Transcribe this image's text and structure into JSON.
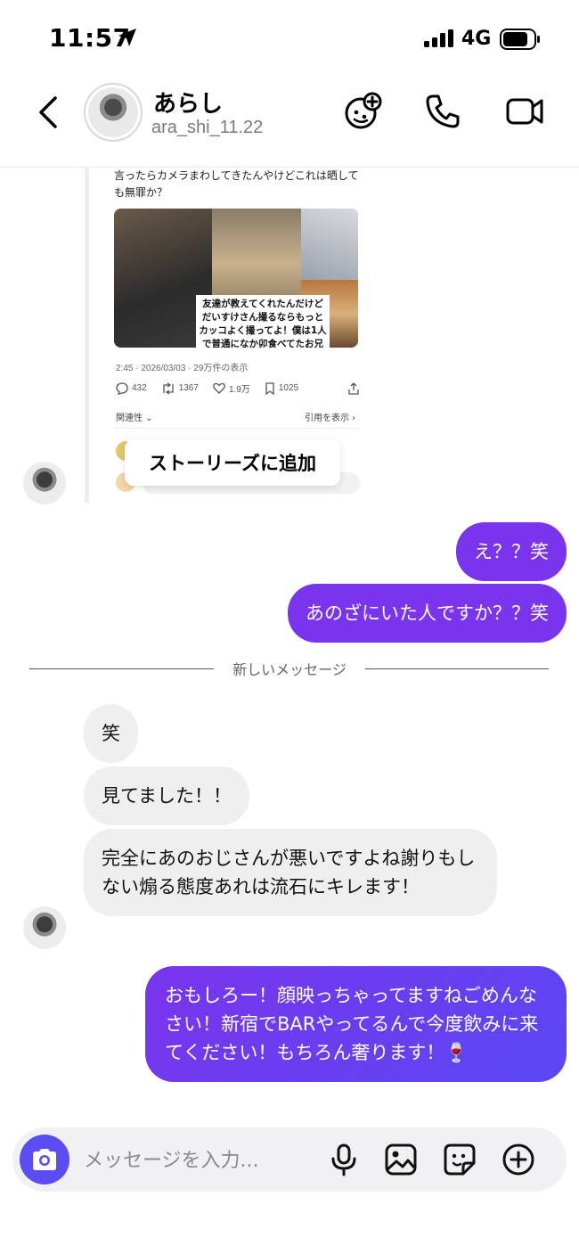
{
  "status_bar": {
    "time": "11:57",
    "network": "4G"
  },
  "header": {
    "name": "あらし",
    "username": "ara_shi_11.22"
  },
  "shared_post": {
    "text": "言ったらカメラまわしてきたんやけどこれは晒しても無罪か？",
    "overlay_text": "友達が教えてくれたんだけどだいすけさん撮るならもっとカッコよく撮ってよ！僕は1人で普通になか卯食べてたお兄さんだよ！うどんこぼしたおじさん謝らないあたり本物の匂いを感じた！@yogidaisuke またこの3人でなか卯行きたいな！",
    "meta": "2:45 · 2026/03/03 · 29万件の表示",
    "stats": {
      "replies": "432",
      "reposts": "1367",
      "likes": "1.9万",
      "bookmarks": "1025"
    },
    "related_label": "関連性",
    "quote_label": "引用を表示",
    "add_to_story": "ストーリーズに追加"
  },
  "messages": {
    "out_1": "え？？笑",
    "out_2": "あのざにいた人ですか？？笑",
    "new_messages_label": "新しいメッセージ",
    "in_1": "笑",
    "in_2": "見てました！！",
    "in_3": "完全にあのおじさんが悪いですよね謝りもしない煽る態度あれは流石にキレます！",
    "out_3": "おもしろー！顔映っちゃってますねごめんなさい！新宿でBARやってるんで今度飲みに来てください！もちろん奢ります！🍷"
  },
  "composer": {
    "placeholder": "メッセージを入力..."
  },
  "colors": {
    "outgoing_bubble": "#7a34ee",
    "incoming_bubble": "#efefef",
    "camera_button": "#5b4cf4"
  }
}
